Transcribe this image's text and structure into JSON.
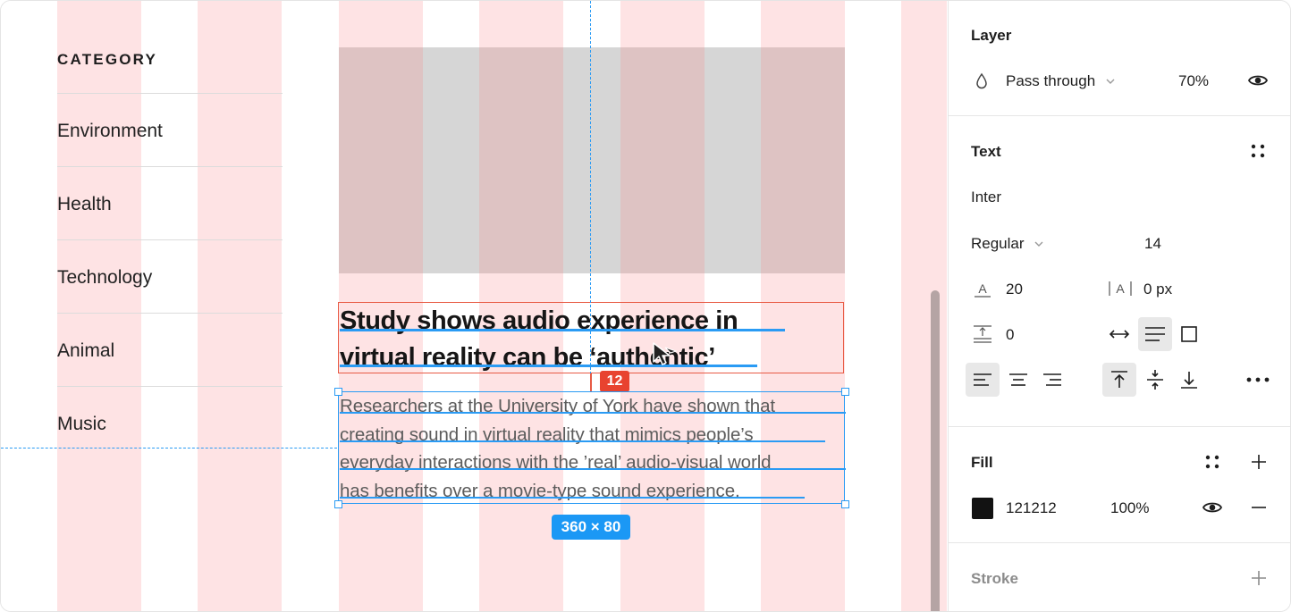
{
  "canvas": {
    "category": {
      "title": "CATEGORY",
      "items": [
        "Environment",
        "Health",
        "Technology",
        "Animal",
        "Music"
      ]
    },
    "article": {
      "headline_line1": "Study shows audio experience in",
      "headline_line2": "virtual reality can be ‘authentic’",
      "body_lines": [
        "Researchers at the University of York have shown that",
        "creating sound in virtual reality that mimics people’s",
        "everyday interactions with the ’real’ audio-visual world",
        "has benefits over a movie-type sound experience."
      ]
    },
    "spacing_badge": "12",
    "size_badge": "360 × 80"
  },
  "panel": {
    "layer": {
      "title": "Layer",
      "blend_mode": "Pass through",
      "opacity": "70%"
    },
    "text": {
      "title": "Text",
      "font_family": "Inter",
      "font_weight": "Regular",
      "font_size": "14",
      "line_height": "20",
      "letter_spacing": "0 px",
      "paragraph_spacing": "0"
    },
    "fill": {
      "title": "Fill",
      "hex": "121212",
      "opacity": "100%",
      "color": "#121212"
    },
    "stroke": {
      "title": "Stroke"
    }
  },
  "colors": {
    "grid_column": "#fee3e4",
    "selection": "#2a9bf4",
    "spacing": "#e8432f"
  }
}
